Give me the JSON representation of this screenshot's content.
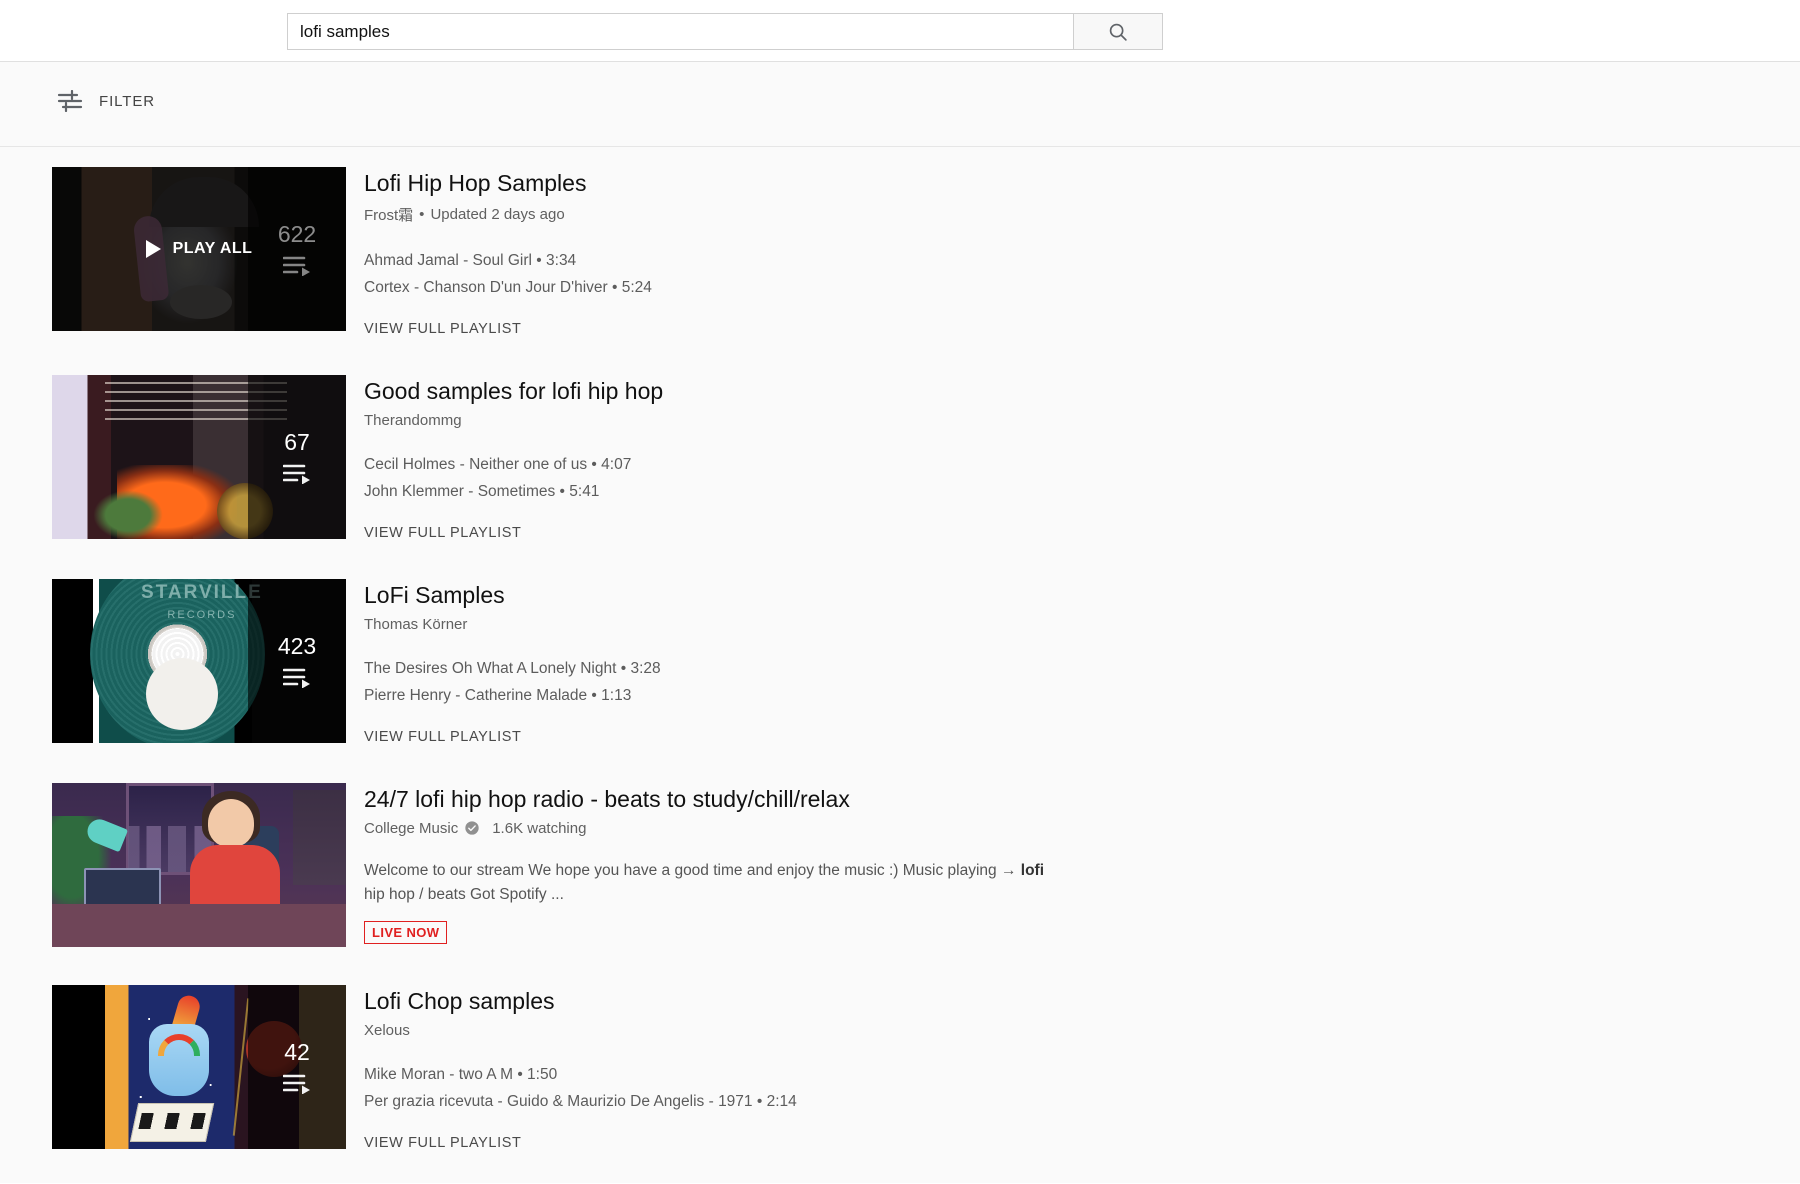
{
  "search": {
    "value": "lofi samples",
    "placeholder": "Search",
    "button_icon": "search-icon"
  },
  "filter": {
    "label": "FILTER",
    "icon": "filter-sliders-icon"
  },
  "results": [
    {
      "type": "playlist",
      "title": "Lofi Hip Hop Samples",
      "channel": "Frost霜",
      "meta": "Updated 2 days ago",
      "meta_separator": "•",
      "video_count": "622",
      "play_all_label": "PLAY ALL",
      "tracks": [
        "Ahmad Jamal - Soul Girl • 3:34",
        "Cortex - Chanson D'un Jour D'hiver • 5:24"
      ],
      "view_full_label": "VIEW FULL PLAYLIST",
      "thumb_art": "art1",
      "hovered": true
    },
    {
      "type": "playlist",
      "title": "Good samples for lofi hip hop",
      "channel": "Therandommg",
      "meta": "",
      "video_count": "67",
      "tracks": [
        "Cecil Holmes - Neither one of us • 4:07",
        "John Klemmer - Sometimes • 5:41"
      ],
      "view_full_label": "VIEW FULL PLAYLIST",
      "thumb_art": "art2",
      "hovered": false
    },
    {
      "type": "playlist",
      "title": "LoFi Samples",
      "channel": "Thomas Körner",
      "meta": "",
      "video_count": "423",
      "tracks": [
        "The Desires Oh What A Lonely Night • 3:28",
        "Pierre Henry - Catherine Malade • 1:13"
      ],
      "view_full_label": "VIEW FULL PLAYLIST",
      "thumb_art": "art3",
      "hovered": false
    },
    {
      "type": "live",
      "title": "24/7 lofi hip hop radio - beats to study/chill/relax",
      "channel": "College Music",
      "verified": true,
      "watching": "1.6K watching",
      "description_before": "Welcome to our stream We hope you have a good time and enjoy the music :) Music playing → ",
      "description_highlight": "lofi",
      "description_after": " hip hop / beats Got Spotify ...",
      "live_badge": "LIVE NOW",
      "thumb_art": "art4"
    },
    {
      "type": "playlist",
      "title": "Lofi Chop samples",
      "channel": "Xelous",
      "meta": "",
      "video_count": "42",
      "tracks": [
        "Mike Moran - two A M • 1:50",
        "Per grazia ricevuta - Guido & Maurizio De Angelis - 1971 • 2:14"
      ],
      "view_full_label": "VIEW FULL PLAYLIST",
      "thumb_art": "art5",
      "hovered": false
    }
  ],
  "colors": {
    "page_bg": "#fafafa",
    "header_bg": "#ffffff",
    "title": "#111111",
    "secondary_text": "#606060",
    "live_red": "#e02020"
  }
}
